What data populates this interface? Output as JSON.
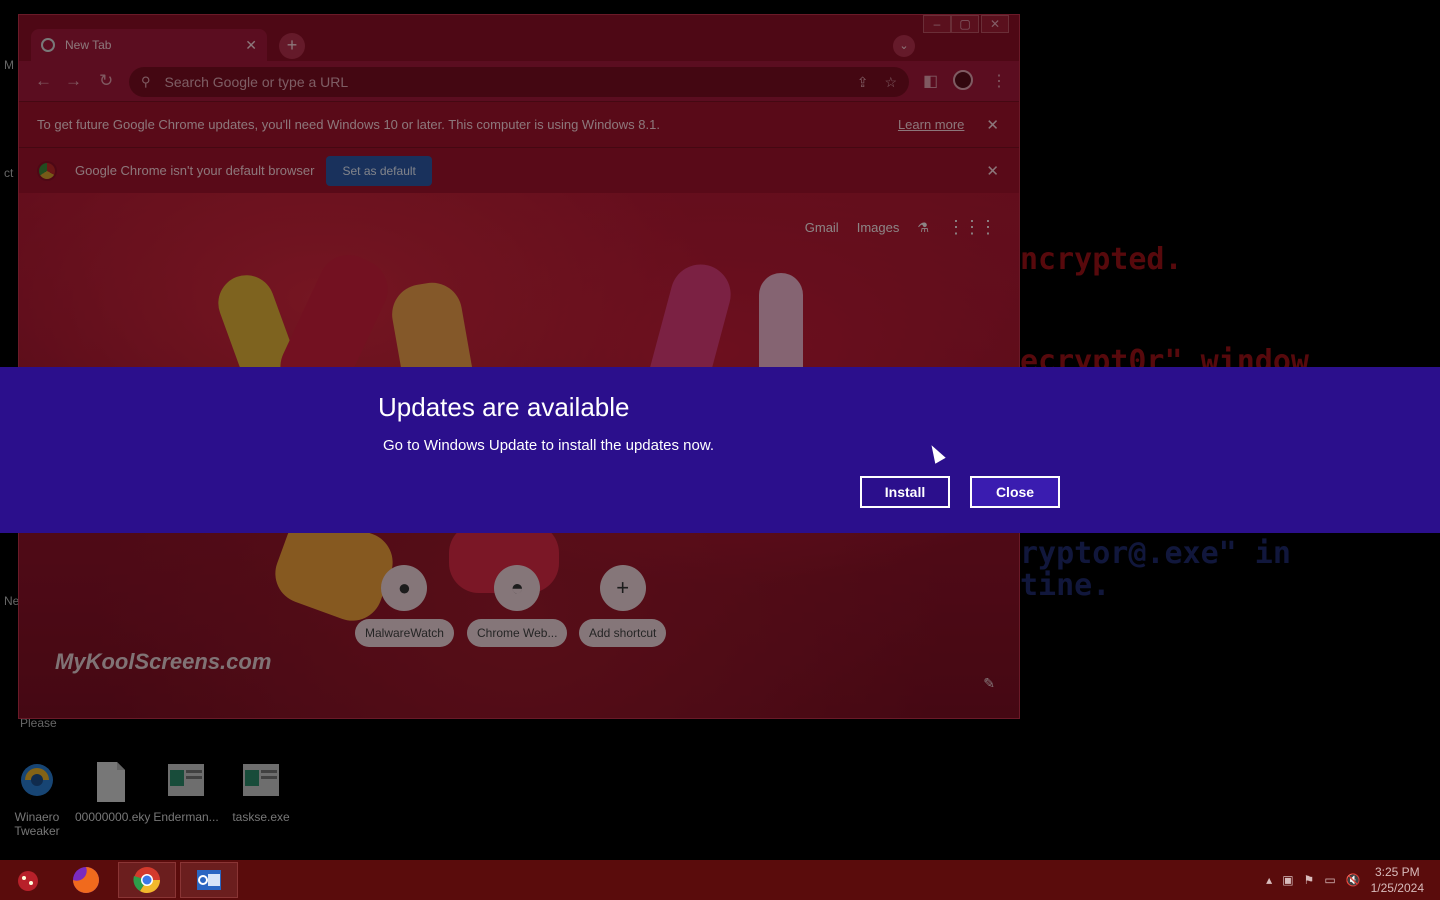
{
  "desktop": {
    "bg_lines": [
      "ncrypted.",
      "ecrypt0r\" window",
      "ryptor@.exe\" in",
      "tine."
    ],
    "left_stubs": [
      "M",
      "ct",
      "Ne",
      "Please"
    ],
    "icons": [
      {
        "label": "Winaero Tweaker",
        "icon": "winaero-icon"
      },
      {
        "label": "00000000.eky",
        "icon": "file-icon"
      },
      {
        "label": "Enderman...",
        "icon": "app-window-icon"
      },
      {
        "label": "taskse.exe",
        "icon": "app-window-icon"
      }
    ]
  },
  "chrome": {
    "tab_title": "New Tab",
    "tab_close": "✕",
    "new_tab": "+",
    "tab_search": "⌄",
    "window_buttons": [
      "–",
      "▢",
      "✕"
    ],
    "nav": {
      "back": "←",
      "forward": "→",
      "reload": "↻"
    },
    "omnibox_placeholder": "Search Google or type a URL",
    "omnibox_icons": {
      "share": "⇪",
      "bookmark": "☆"
    },
    "toolbar_icons": {
      "sidepanel": "◧",
      "menu": "⋮"
    },
    "infobar_update": {
      "message": "To get future Google Chrome updates, you'll need Windows 10 or later. This computer is using Windows 8.1.",
      "link": "Learn more",
      "close": "✕"
    },
    "infobar_default": {
      "message": "Google Chrome isn't your default browser",
      "button": "Set as default",
      "close": "✕"
    },
    "ntp": {
      "gmail": "Gmail",
      "images": "Images",
      "labs_icon": "⚗",
      "apps_icon": "⋮⋮⋮",
      "shortcuts": [
        {
          "label": "MalwareWatch",
          "glyph": "●"
        },
        {
          "label": "Chrome Web...",
          "glyph": "◓"
        },
        {
          "label": "Add shortcut",
          "glyph": "+"
        }
      ],
      "watermark": "MyKoolScreens.com",
      "customize_icon": "✎"
    }
  },
  "update_dialog": {
    "title": "Updates are available",
    "body": "Go to Windows Update to install the updates now.",
    "install_label": "Install",
    "close_label": "Close"
  },
  "taskbar": {
    "clock_time": "3:25 PM",
    "clock_date": "1/25/2024",
    "tray_icons": [
      "▴",
      "▣",
      "⚑",
      "▭",
      "🔇"
    ]
  }
}
